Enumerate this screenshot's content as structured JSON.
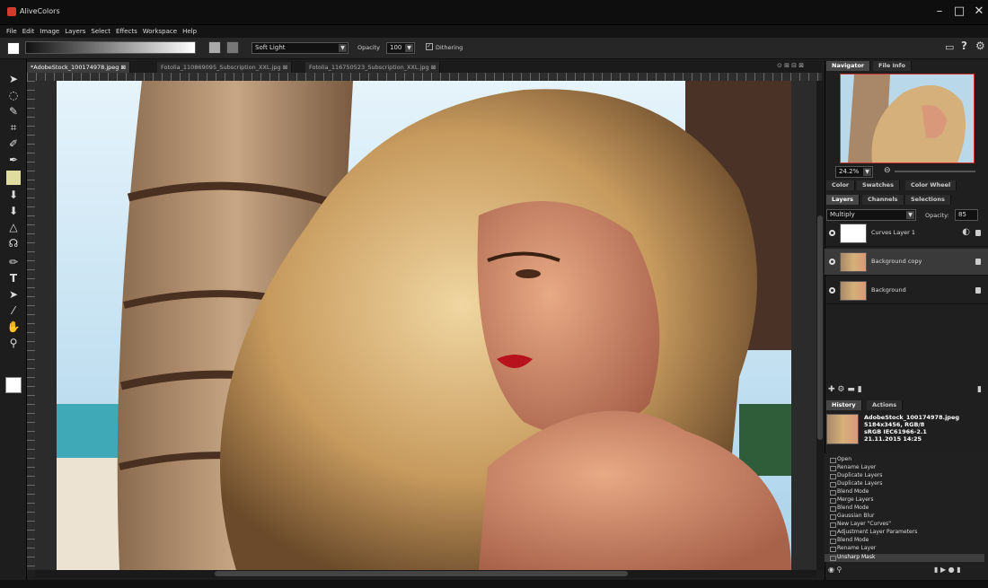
{
  "app": {
    "title": "AliveColors"
  },
  "menu": [
    "File",
    "Edit",
    "Image",
    "Layers",
    "Select",
    "Effects",
    "Workspace",
    "Help"
  ],
  "toolbar": {
    "blend_mode": "Soft Light",
    "opacity_label": "Opacity",
    "opacity_value": "100",
    "dithering_label": "Dithering"
  },
  "tabs": [
    {
      "label": "*AdobeStock_100174978.jpeg"
    },
    {
      "label": "Fotolia_110869095_Subscription_XXL.jpg"
    },
    {
      "label": "Fotolia_116750523_Subscription_XXL.jpg"
    }
  ],
  "navigator": {
    "tabs": [
      "Navigator",
      "File Info"
    ],
    "zoom": "24.2%"
  },
  "color_tabs": [
    "Color",
    "Swatches",
    "Color Wheel"
  ],
  "layer_tabs": [
    "Layers",
    "Channels",
    "Selections"
  ],
  "layers_panel": {
    "blend_mode": "Multiply",
    "opacity_label": "Opacity:",
    "opacity_value": "85"
  },
  "layers": [
    {
      "name": "Curves Layer 1"
    },
    {
      "name": "Background copy"
    },
    {
      "name": "Background"
    }
  ],
  "history_tabs": [
    "History",
    "Actions"
  ],
  "file_info": {
    "name": "AdobeStock_100174978.jpeg",
    "size": "5184x3456, RGB/8",
    "profile": "sRGB IEC61966-2.1",
    "date": "21.11.2015 14:25"
  },
  "history": [
    "Open",
    "Rename Layer",
    "Duplicate Layers",
    "Duplicate Layers",
    "Blend Mode",
    "Merge Layers",
    "Blend Mode",
    "Gaussian Blur",
    "New Layer \"Curves\"",
    "Adjustment Layer Parameters",
    "Blend Mode",
    "Rename Layer",
    "Unsharp Mask"
  ]
}
